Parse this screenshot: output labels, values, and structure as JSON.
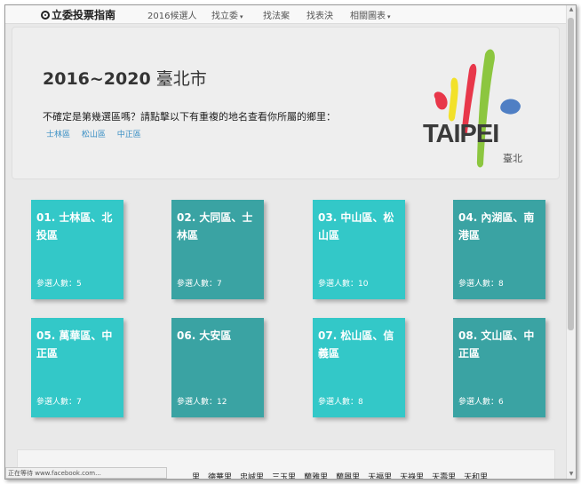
{
  "navbar": {
    "brand": "立委投票指南",
    "items": [
      {
        "label": "2016候選人",
        "has_caret": false
      },
      {
        "label": "找立委",
        "has_caret": true
      },
      {
        "label": "找法案",
        "has_caret": false
      },
      {
        "label": "找表決",
        "has_caret": false
      },
      {
        "label": "相關圖表",
        "has_caret": true
      }
    ],
    "caret_glyph": "▾"
  },
  "hero": {
    "year_range": "2016~2020",
    "city": "臺北市",
    "question": "不確定是第幾選區嗎？請點擊以下有重複的地名查看你所屬的鄉里：",
    "district_links": [
      "士林區",
      "松山區",
      "中正區"
    ],
    "logo_text": "TAIPEI",
    "logo_subtext": "臺北",
    "logo_colors": {
      "yellow": "#f2e12a",
      "red": "#e8374a",
      "green": "#8cc63f",
      "blue": "#4f7fc4"
    }
  },
  "count_label": "參選人數：",
  "cards": [
    {
      "title": "01. 士林區、北投區",
      "count": "5",
      "style": "c1"
    },
    {
      "title": "02. 大同區、士林區",
      "count": "7",
      "style": "c2"
    },
    {
      "title": "03. 中山區、松山區",
      "count": "10",
      "style": "c1"
    },
    {
      "title": "04. 內湖區、南港區",
      "count": "8",
      "style": "c2"
    },
    {
      "title": "05. 萬華區、中正區",
      "count": "7",
      "style": "c1"
    },
    {
      "title": "06. 大安區",
      "count": "12",
      "style": "c2"
    },
    {
      "title": "07. 松山區、信義區",
      "count": "8",
      "style": "c1"
    },
    {
      "title": "08. 文山區、中正區",
      "count": "6",
      "style": "c2"
    }
  ],
  "villages": [
    "里",
    "德華里",
    "忠誠里",
    "三玉里",
    "蘭雅里",
    "蘭興里",
    "天福里",
    "天祿里",
    "天壽里",
    "天和里"
  ],
  "statusbar": "正在等待 www.facebook.com...",
  "colors": {
    "card_light": "#33c8c8",
    "card_dark": "#3aa3a3",
    "link": "#3a8fc4"
  }
}
